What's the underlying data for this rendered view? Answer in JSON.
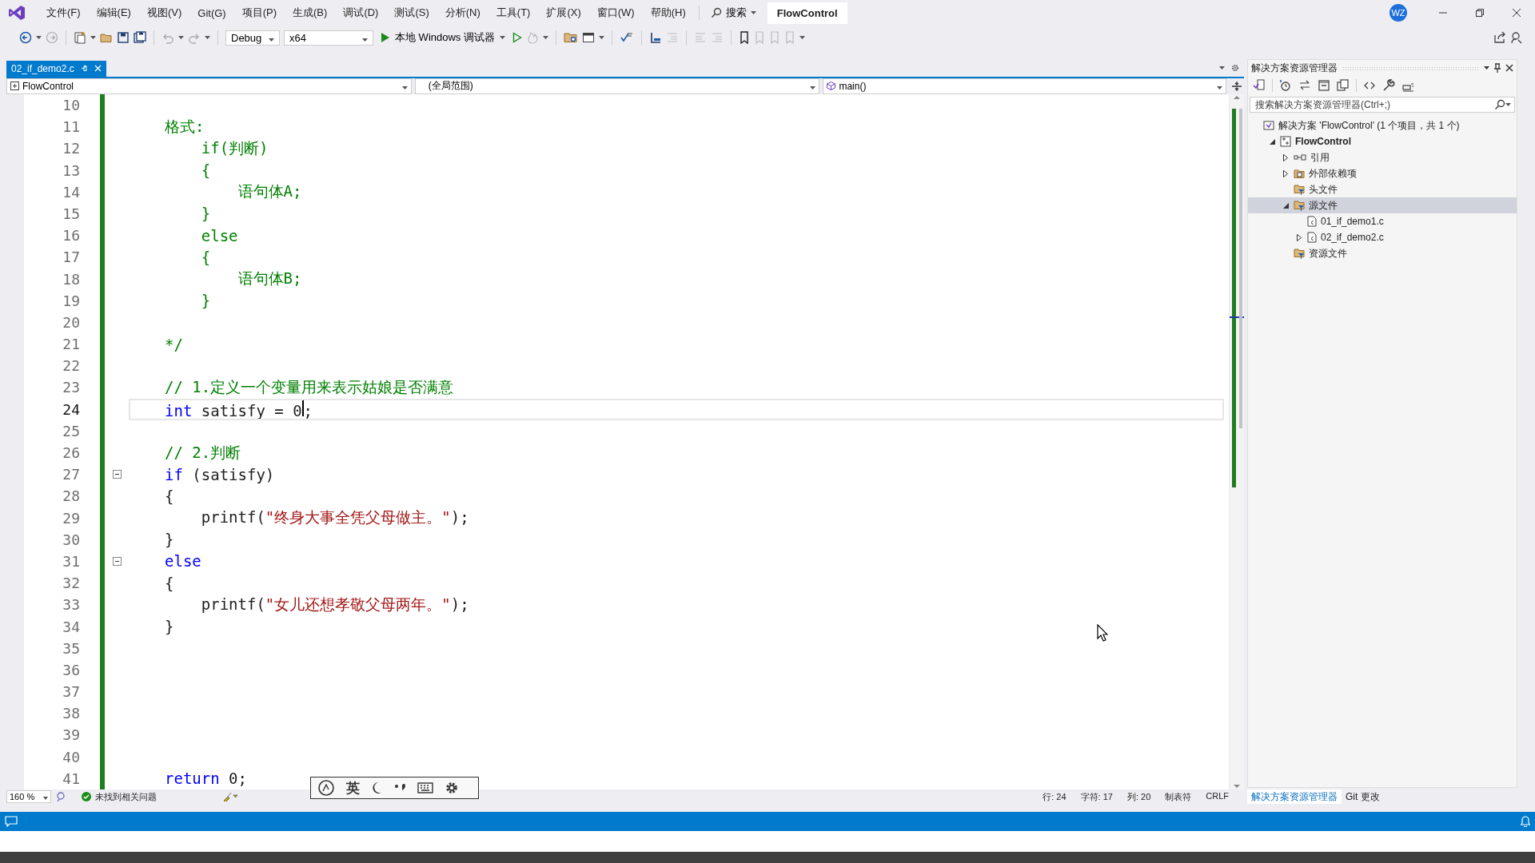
{
  "menu": [
    "文件(F)",
    "编辑(E)",
    "视图(V)",
    "Git(G)",
    "项目(P)",
    "生成(B)",
    "调试(D)",
    "测试(S)",
    "分析(N)",
    "工具(T)",
    "扩展(X)",
    "窗口(W)",
    "帮助(H)"
  ],
  "search_button": "搜索",
  "app_title": "FlowControl",
  "account": "WZ",
  "toolbar": {
    "configuration": "Debug",
    "platform": "x64",
    "run_button": "本地 Windows 调试器"
  },
  "tabs": [
    {
      "label": "02_if_demo2.c",
      "selected": true
    }
  ],
  "nav_bar": {
    "project": "FlowControl",
    "scope": "(全局范围)",
    "member": "main()"
  },
  "editor": {
    "lines": [
      {
        "number": "10",
        "current": false,
        "fold": false
      },
      {
        "number": "11",
        "current": false,
        "fold": false,
        "tokens": [
          {
            "kind": "comment",
            "text": "格式:"
          }
        ]
      },
      {
        "number": "12",
        "current": false,
        "fold": false,
        "tokens": [
          {
            "kind": "comment",
            "text": "    if(判断)"
          }
        ]
      },
      {
        "number": "13",
        "current": false,
        "fold": false,
        "tokens": [
          {
            "kind": "comment",
            "text": "    {"
          }
        ]
      },
      {
        "number": "14",
        "current": false,
        "fold": false,
        "tokens": [
          {
            "kind": "comment",
            "text": "        语句体A;"
          }
        ]
      },
      {
        "number": "15",
        "current": false,
        "fold": false,
        "tokens": [
          {
            "kind": "comment",
            "text": "    }"
          }
        ]
      },
      {
        "number": "16",
        "current": false,
        "fold": false,
        "tokens": [
          {
            "kind": "comment",
            "text": "    else"
          }
        ]
      },
      {
        "number": "17",
        "current": false,
        "fold": false,
        "tokens": [
          {
            "kind": "comment",
            "text": "    {"
          }
        ]
      },
      {
        "number": "18",
        "current": false,
        "fold": false,
        "tokens": [
          {
            "kind": "comment",
            "text": "        语句体B;"
          }
        ]
      },
      {
        "number": "19",
        "current": false,
        "fold": false,
        "tokens": [
          {
            "kind": "comment",
            "text": "    }"
          }
        ]
      },
      {
        "number": "20",
        "current": false,
        "fold": false
      },
      {
        "number": "21",
        "current": false,
        "fold": false,
        "tokens": [
          {
            "kind": "comment",
            "text": "*/"
          }
        ]
      },
      {
        "number": "22",
        "current": false,
        "fold": false
      },
      {
        "number": "23",
        "current": false,
        "fold": false,
        "tokens": [
          {
            "kind": "comment",
            "text": "// 1.定义一个变量用来表示姑娘是否满意"
          }
        ]
      },
      {
        "number": "24",
        "current": true,
        "fold": false,
        "tokens": [
          {
            "kind": "keyword",
            "text": "int"
          },
          {
            "kind": "plain",
            "text": " satisfy = 0"
          },
          {
            "kind": "caret"
          },
          {
            "kind": "plain",
            "text": ";"
          }
        ]
      },
      {
        "number": "25",
        "current": false,
        "fold": false
      },
      {
        "number": "26",
        "current": false,
        "fold": false,
        "tokens": [
          {
            "kind": "comment",
            "text": "// 2.判断"
          }
        ]
      },
      {
        "number": "27",
        "current": false,
        "fold": true,
        "tokens": [
          {
            "kind": "keyword",
            "text": "if"
          },
          {
            "kind": "plain",
            "text": " (satisfy)"
          }
        ]
      },
      {
        "number": "28",
        "current": false,
        "fold": false,
        "tokens": [
          {
            "kind": "plain",
            "text": "{"
          }
        ]
      },
      {
        "number": "29",
        "current": false,
        "fold": false,
        "tokens": [
          {
            "kind": "plain",
            "text": "    printf("
          },
          {
            "kind": "string",
            "text": "\"终身大事全凭父母做主。\""
          },
          {
            "kind": "plain",
            "text": ");"
          }
        ]
      },
      {
        "number": "30",
        "current": false,
        "fold": false,
        "tokens": [
          {
            "kind": "plain",
            "text": "}"
          }
        ]
      },
      {
        "number": "31",
        "current": false,
        "fold": true,
        "tokens": [
          {
            "kind": "keyword",
            "text": "else"
          }
        ]
      },
      {
        "number": "32",
        "current": false,
        "fold": false,
        "tokens": [
          {
            "kind": "plain",
            "text": "{"
          }
        ]
      },
      {
        "number": "33",
        "current": false,
        "fold": false,
        "tokens": [
          {
            "kind": "plain",
            "text": "    printf("
          },
          {
            "kind": "string",
            "text": "\"女儿还想孝敬父母两年。\""
          },
          {
            "kind": "plain",
            "text": ");"
          }
        ]
      },
      {
        "number": "34",
        "current": false,
        "fold": false,
        "tokens": [
          {
            "kind": "plain",
            "text": "}"
          }
        ]
      },
      {
        "number": "35",
        "current": false,
        "fold": false
      },
      {
        "number": "36",
        "current": false,
        "fold": false
      },
      {
        "number": "37",
        "current": false,
        "fold": false
      },
      {
        "number": "38",
        "current": false,
        "fold": false
      },
      {
        "number": "39",
        "current": false,
        "fold": false
      },
      {
        "number": "40",
        "current": false,
        "fold": false
      },
      {
        "number": "41",
        "current": false,
        "fold": false,
        "tokens": [
          {
            "kind": "keyword",
            "text": "return"
          },
          {
            "kind": "plain",
            "text": " 0;"
          }
        ]
      }
    ]
  },
  "editor_footer": {
    "zoom": "160 %",
    "issues": "未找到相关问题"
  },
  "ime_bar": {
    "language": "英"
  },
  "status_info": [
    "行: 24",
    "字符: 17",
    "列: 20",
    "制表符",
    "CRLF"
  ],
  "solution_explorer": {
    "title": "解决方案资源管理器",
    "search": {
      "placeholder": "搜索解决方案资源管理器(Ctrl+;)"
    },
    "tree": [
      {
        "label": "解决方案 'FlowControl' (1 个项目，共 1 个)",
        "kind": "solution",
        "selected": false,
        "children": [
          {
            "label": "FlowControl",
            "kind": "project",
            "selected": false,
            "expanded": true,
            "children": [
              {
                "label": "引用",
                "kind": "references",
                "selected": false,
                "expanded": false
              },
              {
                "label": "外部依赖项",
                "kind": "external",
                "selected": false,
                "expanded": false
              },
              {
                "label": "头文件",
                "kind": "filter",
                "selected": false
              },
              {
                "label": "源文件",
                "kind": "filter",
                "selected": true,
                "expanded": true,
                "children": [
                  {
                    "label": "01_if_demo1.c",
                    "kind": "file",
                    "selected": false
                  },
                  {
                    "label": "02_if_demo2.c",
                    "kind": "file",
                    "selected": false,
                    "expanded": false
                  }
                ]
              },
              {
                "label": "资源文件",
                "kind": "filter",
                "selected": false
              }
            ]
          }
        ]
      }
    ],
    "bottom_tabs": [
      {
        "label": "解决方案资源管理器",
        "selected": true
      },
      {
        "label": "Git 更改",
        "selected": false
      }
    ]
  }
}
